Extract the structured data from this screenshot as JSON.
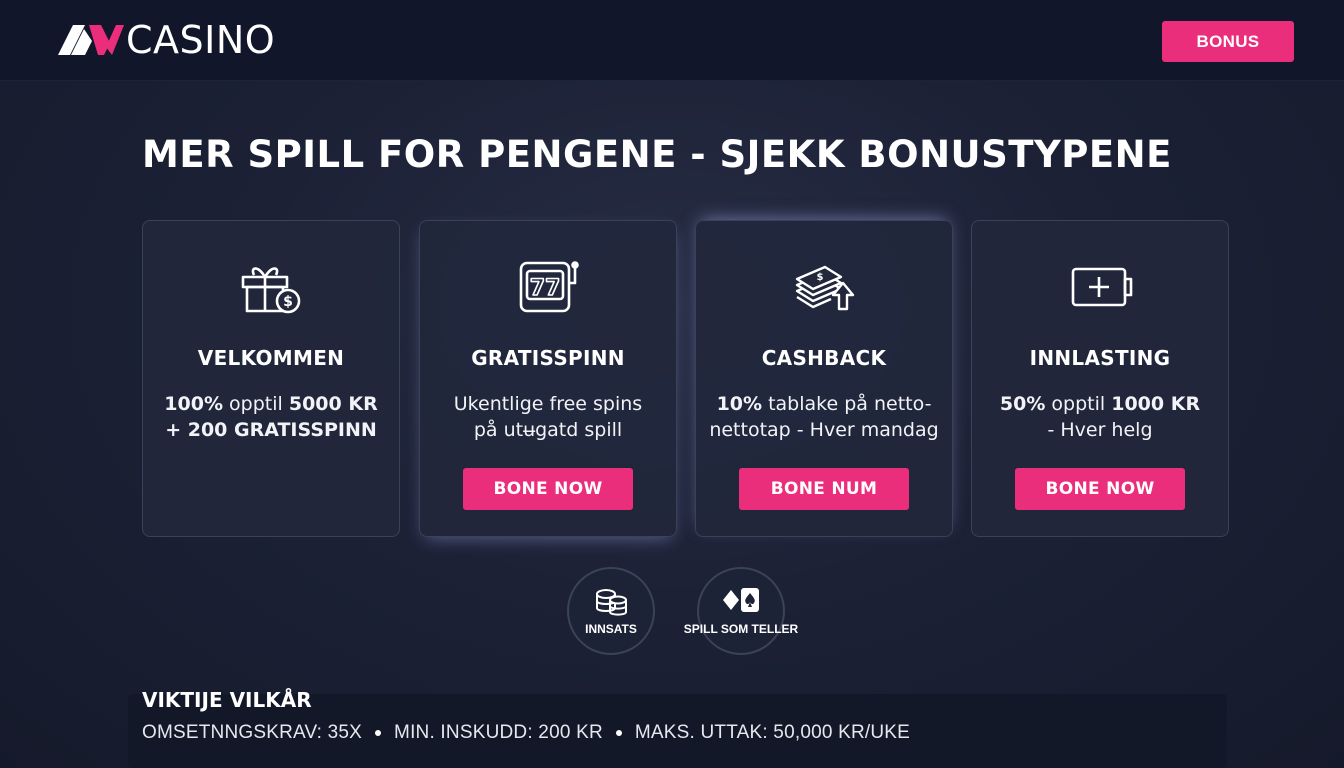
{
  "brand": {
    "logo_text": "CASINO",
    "accent_color": "#ea2e7b",
    "logo_mark_name": "av-logo"
  },
  "header": {
    "bonus_button_label": "BONUS"
  },
  "headline": "MER SPILL FOR PENGENE - SJEKK BONUSTYPENE",
  "cards": [
    {
      "icon": "gift-dollar-icon",
      "title": "VELKOMMEN",
      "desc_line1_prefix": "100%",
      "desc_line1_mid": " opptil ",
      "desc_line1_strong": "5000 KR",
      "desc_line2": "+ 200 GRATISSPINN",
      "button_label": ""
    },
    {
      "icon": "slot-machine-icon",
      "title": "GRATISSPINN",
      "desc_line1": "Ukentlige free spins",
      "desc_line2": "på utʉgatd spill",
      "button_label": "BONE NOW"
    },
    {
      "icon": "cash-stack-up-icon",
      "title": "CASHBACK",
      "desc_line1_strong": "10%",
      "desc_line1_rest": " tablake på netto-",
      "desc_line2": "nettotap - Hver mandag",
      "button_label": "BONE NUM"
    },
    {
      "icon": "battery-plus-icon",
      "title": "INNLASTING",
      "desc_line1_strong1": "50%",
      "desc_line1_mid": " opptil ",
      "desc_line1_strong2": "1000 KR",
      "desc_line2": "- Hver helg",
      "button_label": "BONE NOW"
    }
  ],
  "circles": [
    {
      "icon": "coin-stack-icon",
      "label": "INNSATS"
    },
    {
      "icon": "cards-suits-icon",
      "label": "SPILL SOM TELLER"
    }
  ],
  "terms": {
    "title": "VIKTIJE VILKÅR",
    "items": [
      "OMSETNNGSKRAV: 35X",
      "MIN. INSKUDD: 200 KR",
      "MAKS. UTTAK: 50,000 KR/UKE"
    ]
  }
}
